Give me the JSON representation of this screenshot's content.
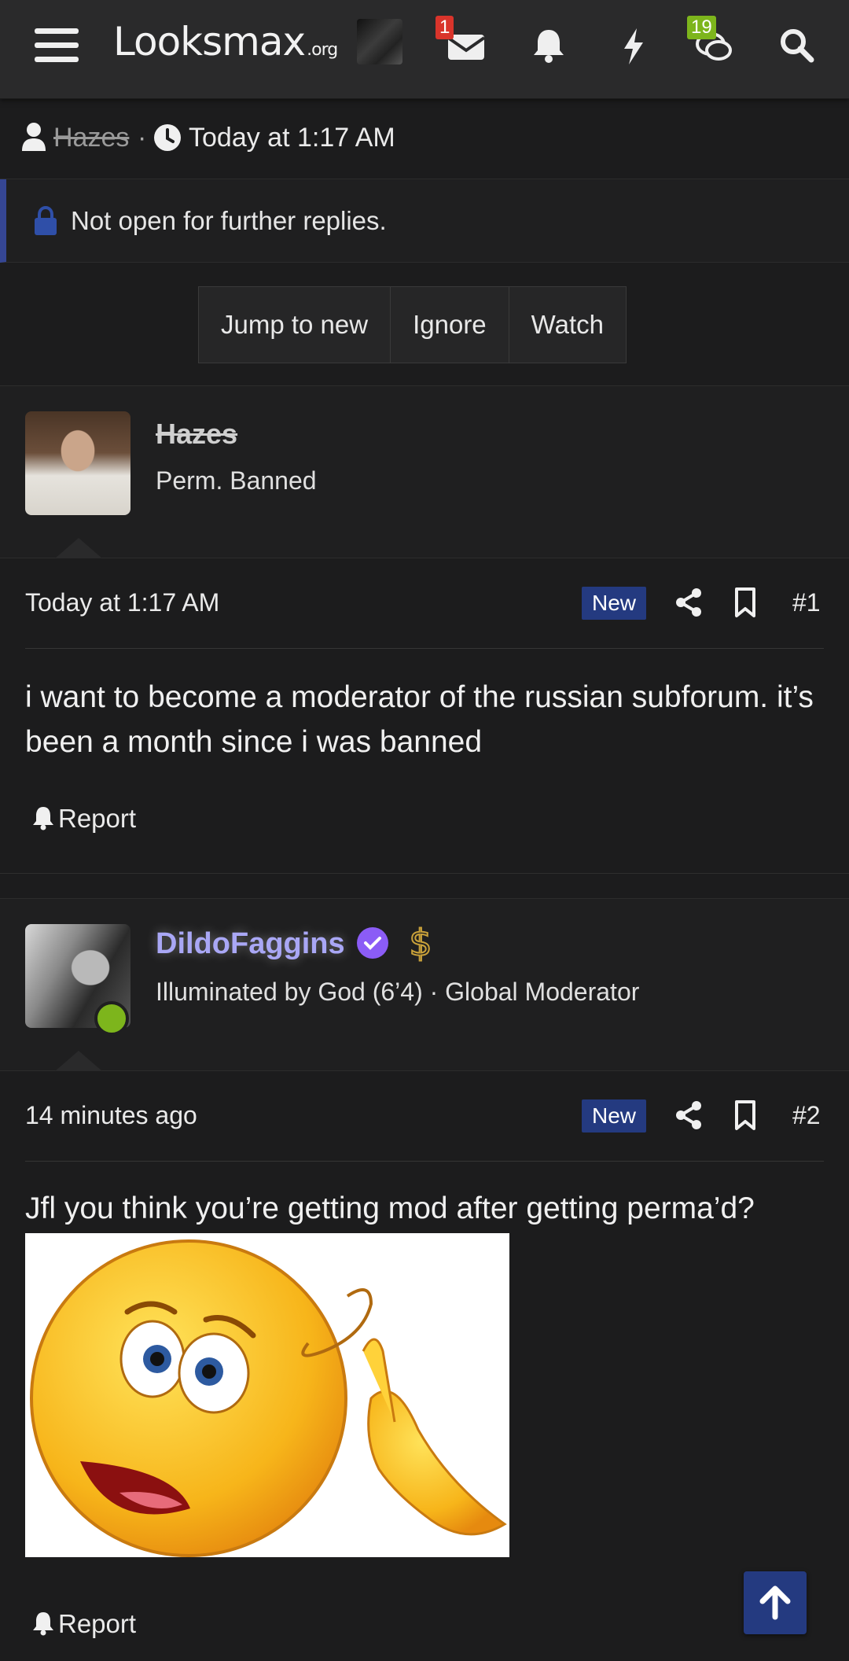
{
  "nav": {
    "logo_main": "Looksmax",
    "logo_suffix": ".org",
    "inbox_badge": "1",
    "chat_badge": "19"
  },
  "thread": {
    "author": "Hazes",
    "separator": "·",
    "time": "Today at 1:17 AM",
    "locked_notice": "Not open for further replies.",
    "buttons": [
      "Jump to new",
      "Ignore",
      "Watch"
    ]
  },
  "posts": [
    {
      "username": "Hazes",
      "user_title": "Perm. Banned",
      "time": "Today at 1:17 AM",
      "badge": "New",
      "number": "#1",
      "body": "i want to become a moderator of the russian subforum. it’s been a month since i was banned",
      "report": "Report"
    },
    {
      "username": "DildoFaggins",
      "user_title": "Illuminated by God (6’4) · Global Moderator",
      "time": "14 minutes ago",
      "badge": "New",
      "number": "#2",
      "body": "Jfl you think you’re getting mod after getting perma’d?",
      "report": "Report"
    }
  ],
  "colors": {
    "accent": "#243a80",
    "moderator_name": "#a9a7f5",
    "online": "#7db51c",
    "notification_red": "#d9342b"
  }
}
